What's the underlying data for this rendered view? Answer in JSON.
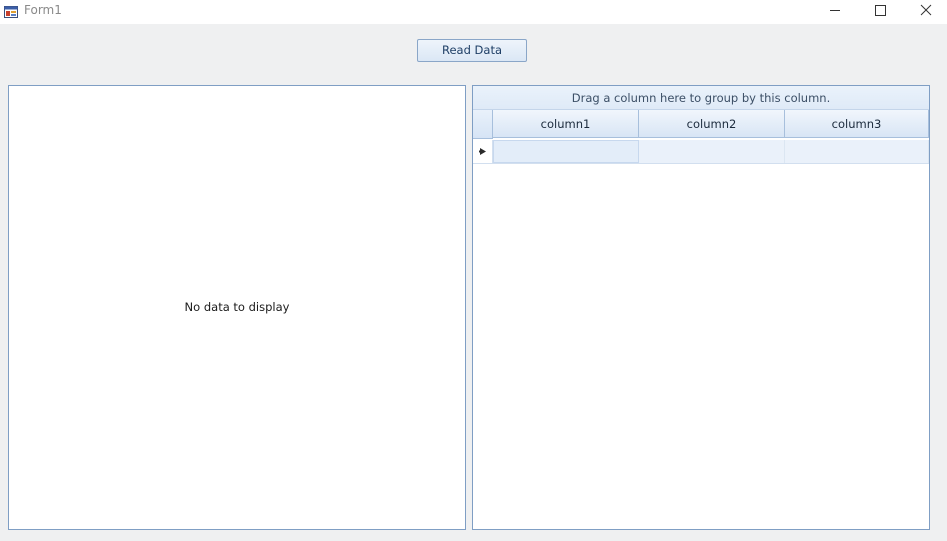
{
  "window": {
    "title": "Form1",
    "icons": {
      "app": "form-app-icon",
      "minimize": "minimize-icon",
      "maximize": "maximize-icon",
      "close": "close-icon"
    }
  },
  "toolbar": {
    "read_data_label": "Read Data"
  },
  "left_panel": {
    "empty_text": "No data to display"
  },
  "grid": {
    "group_panel_text": "Drag a column here to group by this column.",
    "columns": [
      "column1",
      "column2",
      "column3"
    ],
    "rows": [
      {
        "column1": "",
        "column2": "",
        "column3": ""
      }
    ],
    "current_row_icon": "current-row-arrow-icon"
  },
  "colors": {
    "border_accent": "#7f9ec4",
    "header_fill": "#d8e5f5",
    "selected_row": "#eaf1fa"
  }
}
